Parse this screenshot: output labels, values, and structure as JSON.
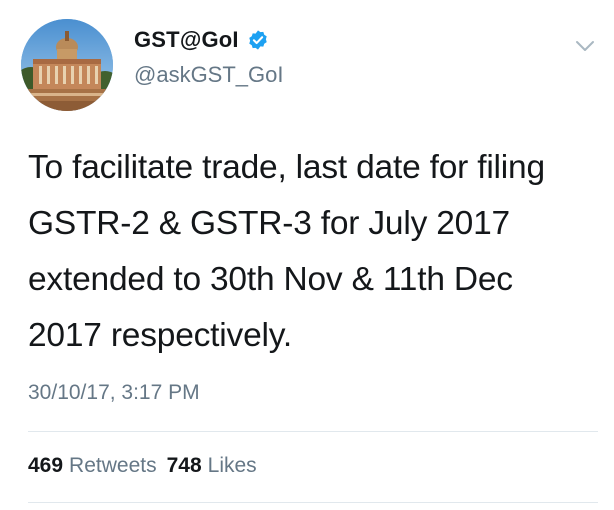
{
  "account": {
    "display_name": "GST@GoI",
    "handle": "@askGST_GoI",
    "verified": true,
    "avatar_icon": "building-avatar-icon"
  },
  "tweet": {
    "lines": [
      "To facilitate trade, last date for filing",
      "GSTR-2 & GSTR-3 for July 2017",
      "extended to 30th Nov & 11th Dec",
      "2017 respectively."
    ],
    "timestamp": "30/10/17, 3:17 PM"
  },
  "stats": {
    "retweets_count": "469",
    "retweets_label": "Retweets",
    "likes_count": "748",
    "likes_label": "Likes"
  },
  "colors": {
    "text": "#14171a",
    "muted": "#657786",
    "verified": "#1da1f2",
    "divider": "#e1e8ed"
  }
}
